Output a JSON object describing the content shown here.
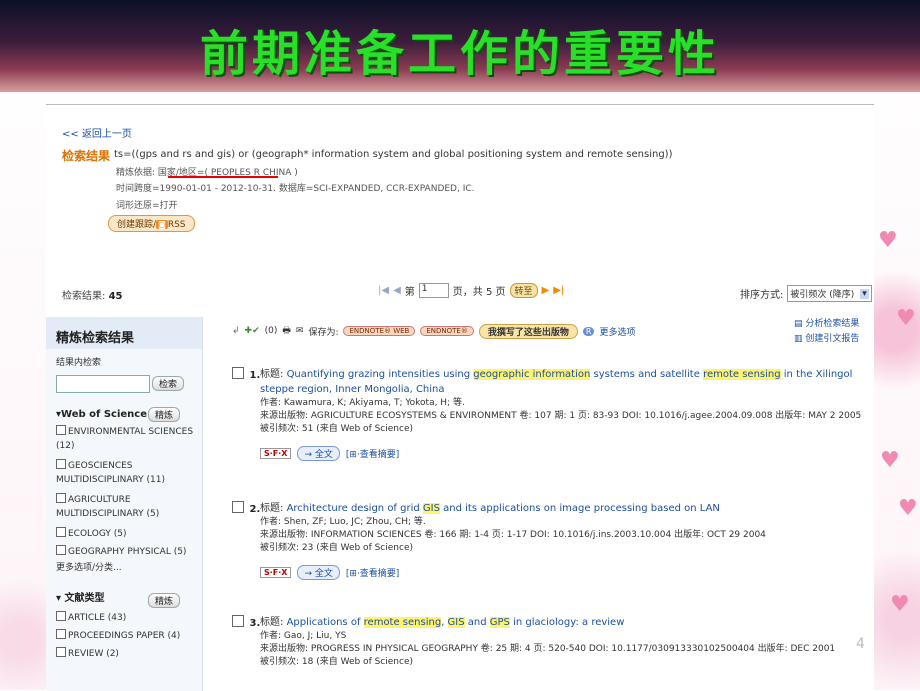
{
  "banner": {
    "title": "前期准备工作的重要性"
  },
  "header": {
    "back_link": "<< 返回上一页",
    "results_label": "检索结果",
    "query": "ts=((gps and rs and gis) or (geograph* information system and global positioning system and remote sensing))",
    "refine_line": "精炼依据: 国家/地区=( PEOPLES R CHINA )",
    "timespan_line": "时间跨度=1990-01-01 - 2012-10-31. 数据库=SCI-EXPANDED, CCR-EXPANDED, IC.",
    "lemma_line": "词形还原=打开",
    "track_button": "创建跟踪",
    "rss_label": "RSS"
  },
  "results_bar": {
    "count_label": "检索结果:",
    "count": "45",
    "page_prefix": "第",
    "page_value": "1",
    "page_suffix": "页，共 5 页",
    "go_button": "转至",
    "sort_label": "排序方式:",
    "sort_value": "被引频次 (降序)"
  },
  "sidebar": {
    "title": "精炼检索结果",
    "within_label": "结果内检索",
    "search_button": "检索",
    "wos_heading": "Web of Science 类别",
    "refine_button": "精炼",
    "wos_categories": [
      "ENVIRONMENTAL SCIENCES (12)",
      "GEOSCIENCES MULTIDISCIPLINARY (11)",
      "AGRICULTURE MULTIDISCIPLINARY (5)",
      "ECOLOGY (5)",
      "GEOGRAPHY PHYSICAL (5)"
    ],
    "more_options": "更多选项/分类...",
    "doctype_heading": "文献类型",
    "doctype_refine_button": "精炼",
    "doctypes": [
      "ARTICLE (43)",
      "PROCEEDINGS PAPER (4)",
      "REVIEW (2)"
    ]
  },
  "toolbar": {
    "checked_count": "(0)",
    "save_to": "保存为:",
    "endnote_web": "ENDNOTE® WEB",
    "endnote": "ENDNOTE®",
    "my_pubs": "我撰写了这些出版物",
    "r_badge": "R",
    "more_options": "更多选项",
    "analyze": "分析检索结果",
    "citation_report": "创建引文报告"
  },
  "records": [
    {
      "num": "1.",
      "title_label": "标题:",
      "title_parts": [
        "Quantifying grazing intensities using ",
        "geographic information",
        " systems and satellite ",
        "remote sensing",
        " in the Xilingol steppe region, Inner Mongolia, China"
      ],
      "authors": "作者: Kawamura, K; Akiyama, T; Yokota, H; 等.",
      "source": "来源出版物: AGRICULTURE ECOSYSTEMS & ENVIRONMENT  卷: 107  期: 1  页: 83-93  DOI: 10.1016/j.agee.2004.09.008  出版年: MAY 2 2005",
      "cited": "被引频次: 51 (来自 Web of Science)",
      "sfx": "S·F·X",
      "fulltext": "→ 全文",
      "abstract": "[⊞·查看摘要]"
    },
    {
      "num": "2.",
      "title_label": "标题:",
      "title_parts": [
        "Architecture design of grid ",
        "GIS",
        " and its applications on image processing based on LAN"
      ],
      "authors": "作者: Shen, ZF; Luo, JC; Zhou, CH; 等.",
      "source": "来源出版物: INFORMATION SCIENCES  卷: 166  期: 1-4  页: 1-17  DOI: 10.1016/j.ins.2003.10.004  出版年: OCT 29 2004",
      "cited": "被引频次: 23 (来自 Web of Science)",
      "sfx": "S·F·X",
      "fulltext": "→ 全文",
      "abstract": "[⊞·查看摘要]"
    },
    {
      "num": "3.",
      "title_label": "标题:",
      "title_parts": [
        "Applications of ",
        "remote sensing",
        ", ",
        "GIS",
        " and ",
        "GPS",
        " in glaciology: a review"
      ],
      "authors": "作者: Gao, J; Liu, YS",
      "source": "来源出版物: PROGRESS IN PHYSICAL GEOGRAPHY  卷: 25  期: 4  页: 520-540  DOI: 10.1177/030913330102500404  出版年: DEC 2001",
      "cited": "被引频次: 18 (来自 Web of Science)"
    }
  ],
  "slide_page": "4"
}
